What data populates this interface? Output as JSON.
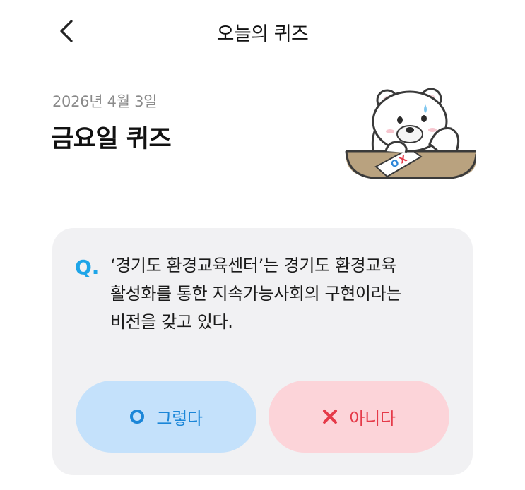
{
  "header": {
    "title": "오늘의 퀴즈",
    "back_icon": "chevron-left-icon"
  },
  "quiz": {
    "date": "2026년 4월 3일",
    "title": "금요일 퀴즈",
    "question_marker": "Q.",
    "question": "‘경기도 환경교육센터’는 경기도 환경교육 활성화를 통한 지속가능사회의 구현이라는 비전을 갖고 있다."
  },
  "answers": {
    "yes_label": "그렇다",
    "no_label": "아니다",
    "yes_icon": "circle-o-icon",
    "no_icon": "x-mark-icon"
  },
  "colors": {
    "accent_blue": "#1ea5e8",
    "yes_bg": "#c4e1fb",
    "yes_text": "#1b86d8",
    "no_bg": "#fcd4d9",
    "no_text": "#e53a49",
    "card_bg": "#f1f1f3"
  }
}
